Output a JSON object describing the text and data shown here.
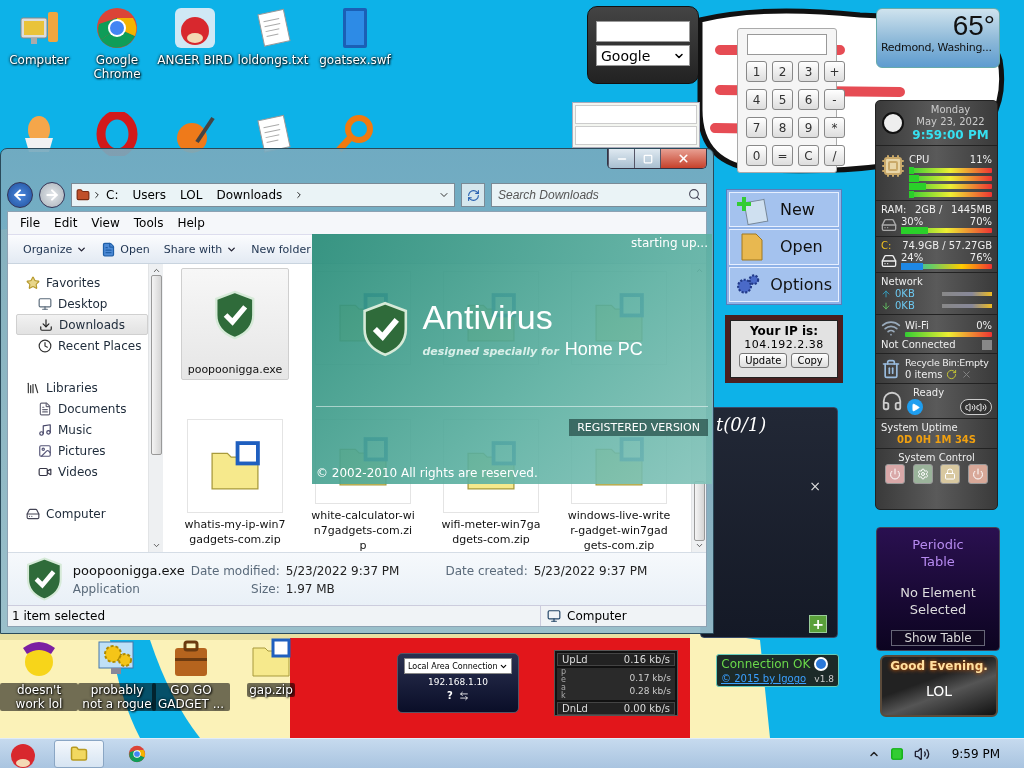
{
  "desktop_icons_top": [
    {
      "label": "Computer",
      "kind": "computer"
    },
    {
      "label": "Google Chrome",
      "kind": "chrome"
    },
    {
      "label": "ANGER BIRD",
      "kind": "bird"
    },
    {
      "label": "loldongs.txt",
      "kind": "text"
    },
    {
      "label": "goatsex.swf",
      "kind": "flash"
    },
    {
      "kind": "egg"
    },
    {
      "kind": "opera"
    },
    {
      "kind": "ball"
    },
    {
      "kind": "text"
    },
    {
      "kind": "magnifier"
    }
  ],
  "desktop_icons_bottom": [
    {
      "label": "doesn't work lol",
      "kind": "yahoo"
    },
    {
      "label": "probably not a rogue",
      "kind": "gears"
    },
    {
      "label": "GO GO GADGET ...",
      "kind": "briefcase"
    },
    {
      "label": "gap.zip",
      "kind": "zip"
    }
  ],
  "explorer": {
    "crumbs": [
      "C:",
      "Users",
      "LOL",
      "Downloads"
    ],
    "search": {
      "placeholder": "Search Downloads"
    },
    "menu": [
      "File",
      "Edit",
      "View",
      "Tools",
      "Help"
    ],
    "toolbar": [
      {
        "label": "Organize",
        "kind": "menu"
      },
      {
        "label": "Open",
        "kind": "open"
      },
      {
        "label": "Share with",
        "kind": "menu"
      },
      {
        "label": "New folder",
        "kind": "plain"
      }
    ],
    "nav": [
      {
        "label": "Favorites",
        "kind": "favorites",
        "selected": false,
        "children": [
          {
            "label": "Desktop",
            "kind": "desktop",
            "selected": false
          },
          {
            "label": "Downloads",
            "kind": "downloads",
            "selected": true
          },
          {
            "label": "Recent Places",
            "kind": "recent",
            "selected": false
          }
        ]
      },
      {
        "label": "Libraries",
        "kind": "libraries",
        "selected": false,
        "children": [
          {
            "label": "Documents",
            "kind": "documents",
            "selected": false
          },
          {
            "label": "Music",
            "kind": "music",
            "selected": false
          },
          {
            "label": "Pictures",
            "kind": "pictures",
            "selected": false
          },
          {
            "label": "Videos",
            "kind": "videos",
            "selected": false
          }
        ]
      },
      {
        "label": "Computer",
        "kind": "computer",
        "selected": false
      }
    ],
    "files": [
      {
        "name": "poopoonigga.exe",
        "kind": "exe",
        "selected": true
      },
      {
        "kind": "zip",
        "selected": false
      },
      {
        "kind": "zip",
        "selected": false
      },
      {
        "kind": "zip",
        "selected": false
      },
      {
        "name": "whatis-my-ip-win7gadgets-com.zip",
        "kind": "zip",
        "selected": false
      },
      {
        "name": "white-calculator-win7gadgets-com.zip",
        "kind": "zip",
        "selected": false
      },
      {
        "name": "wifi-meter-win7gadgets-com.zip",
        "kind": "zip",
        "selected": false
      },
      {
        "name": "windows-live-writer-gadget-win7gadgets-com.zip",
        "kind": "zip",
        "selected": false
      }
    ],
    "details": {
      "name": "poopoonigga.exe",
      "type": "Application",
      "fields": [
        {
          "label": "Date modified:",
          "value": "5/23/2022 9:37 PM"
        },
        {
          "label": "Size:",
          "value": "1.97 MB"
        },
        {
          "label": "Date created:",
          "value": "5/23/2022 9:37 PM"
        }
      ]
    },
    "status_bar": {
      "selection": "1 item selected",
      "location": "Computer"
    }
  },
  "splash": {
    "status": "starting up...",
    "title": "Antivirus",
    "tagline": "designed specially for",
    "edition": "Home PC",
    "badge": "REGISTERED VERSION",
    "copyright": "© 2002-2010 All rights are reserved."
  },
  "search_gadget": {
    "engine": "Google"
  },
  "calculator": {
    "keys": [
      "1",
      "2",
      "3",
      "+",
      "4",
      "5",
      "6",
      "-",
      "7",
      "8",
      "9",
      "*",
      "0",
      "=",
      "C",
      "/"
    ]
  },
  "launcher": [
    {
      "label": "New",
      "kind": "new"
    },
    {
      "label": "Open",
      "kind": "open"
    },
    {
      "label": "Options",
      "kind": "options"
    }
  ],
  "ip_gadget": {
    "heading": "Your IP is:",
    "ip": "104.192.2.38",
    "buttons": [
      "Update",
      "Copy"
    ]
  },
  "notes_panel": {
    "title": "t(0/1)",
    "close": "×",
    "add": "+"
  },
  "weather": {
    "temperature": "65°",
    "location": "Redmond, Washing..."
  },
  "system_monitor": {
    "day": "Monday",
    "date": "May 23, 2022",
    "time": "9:59:00 PM",
    "cpu": {
      "label": "CPU",
      "reading": "11%",
      "cores": [
        {
          "level": 0.06
        },
        {
          "level": 0.12
        },
        {
          "level": 0.2
        },
        {
          "level": 0.06
        }
      ]
    },
    "ram": {
      "label": "RAM:",
      "total": "2GB /",
      "free": "1445MB",
      "used_pct": "30%",
      "free_pct": "70%",
      "level": 0.3
    },
    "disk": {
      "label": "C:",
      "sizes": "74.9GB / 57.27GB",
      "used_pct": "24%",
      "free_pct": "76%",
      "level": 0.24
    },
    "network": {
      "label": "Network",
      "up": "0KB",
      "down": "0KB"
    },
    "wifi": {
      "label": "Wi-Fi",
      "reading": "0%",
      "status": "Not Connected",
      "checked": false
    },
    "recycle": {
      "status": "Recycle Bin:Empty",
      "count": "0 items"
    },
    "media": {
      "status": "Ready"
    },
    "uptime": {
      "label": "System Uptime",
      "value": "0D 0H 1M 34S"
    },
    "control": {
      "label": "System Control"
    }
  },
  "periodic": {
    "title": "Periodic Table",
    "status": "No Element Selected",
    "button": "Show Table"
  },
  "greeting": {
    "title": "Good Evening.",
    "name": "LOL"
  },
  "connection": {
    "status": "Connection OK",
    "credit": "© 2015 by Igogo",
    "version": "v1.8"
  },
  "lan_gadget": {
    "adapter": "Local Area Connection",
    "ip": "192.168.1.10",
    "help": "?"
  },
  "net_meter": {
    "rows": [
      {
        "label": "UpLd",
        "value": "0.16 kb/s"
      },
      {
        "label": "DnLd",
        "value": "0.00 kb/s"
      }
    ],
    "peak_label": "peak",
    "peaks": [
      "0.17 kb/s",
      "0.28 kb/s"
    ]
  },
  "taskbar": {
    "buttons": [
      {
        "kind": "explorer",
        "selected": true
      },
      {
        "kind": "chrome",
        "selected": false
      }
    ],
    "clock": "9:59 PM"
  }
}
